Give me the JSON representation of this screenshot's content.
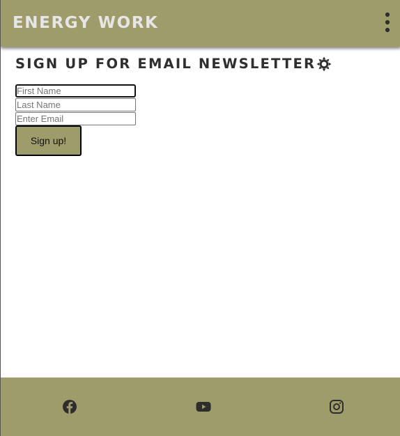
{
  "header": {
    "brand": "ENERGY WORK",
    "menu_icon": "kebab-menu-icon"
  },
  "newsletter": {
    "title": "SIGN UP FOR EMAIL NEWSLETTER",
    "title_icon": "sun-icon",
    "first_name_placeholder": "First Name",
    "last_name_placeholder": "Last Name",
    "email_placeholder": "Enter Email",
    "submit_label": "Sign up!"
  },
  "footer": {
    "social": [
      "facebook-icon",
      "youtube-icon",
      "instagram-icon"
    ]
  },
  "colors": {
    "brand_olive": "#9f9c6b",
    "brand_text": "#e6e6e6",
    "dark_text": "#2f2f2f"
  }
}
